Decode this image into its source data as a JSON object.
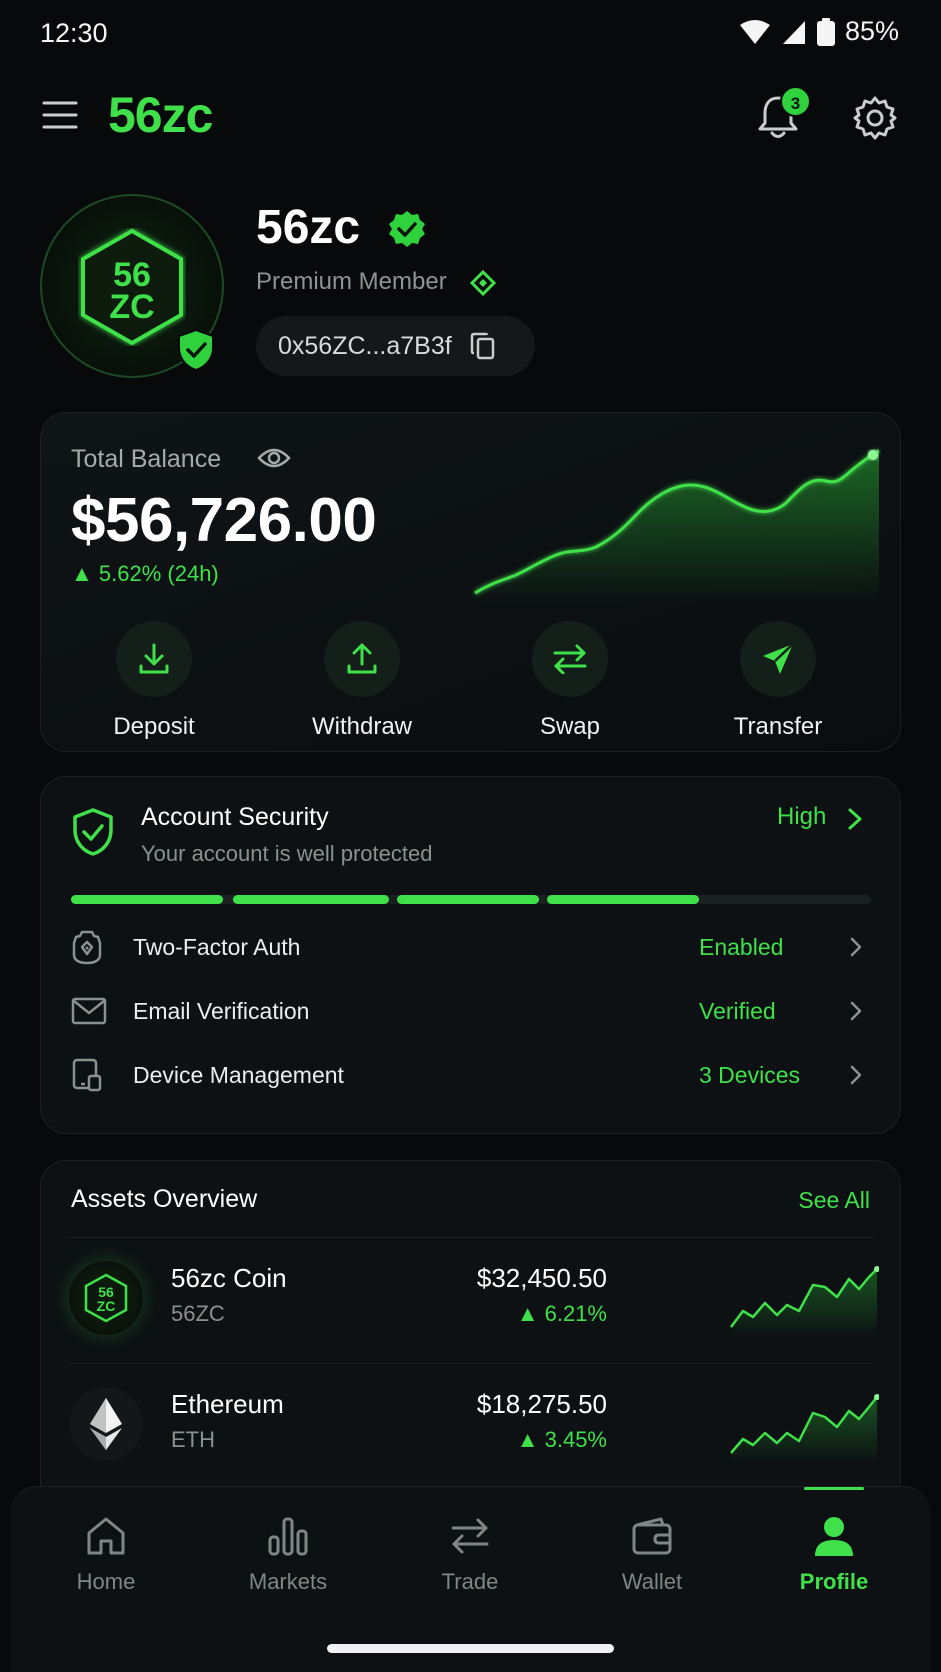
{
  "status_bar": {
    "time": "12:30",
    "battery": "85%"
  },
  "header": {
    "brand": "56zc",
    "notification_count": "3"
  },
  "profile": {
    "avatar_text_top": "56",
    "avatar_text_bottom": "ZC",
    "name": "56zc",
    "membership": "Premium Member",
    "wallet_address": "0x56ZC...a7B3f"
  },
  "balance": {
    "label": "Total Balance",
    "amount": "$56,726.00",
    "change": "5.62% (24h)",
    "actions": [
      {
        "label": "Deposit",
        "icon": "download-icon"
      },
      {
        "label": "Withdraw",
        "icon": "upload-icon"
      },
      {
        "label": "Swap",
        "icon": "swap-icon"
      },
      {
        "label": "Transfer",
        "icon": "send-icon"
      }
    ]
  },
  "security": {
    "title": "Account Security",
    "subtitle": "Your account is well protected",
    "level": "High",
    "level_segments_filled": 4,
    "level_segments_total": 5,
    "items": [
      {
        "label": "Two-Factor Auth",
        "value": "Enabled",
        "icon": "authenticator-icon"
      },
      {
        "label": "Email Verification",
        "value": "Verified",
        "icon": "mail-icon"
      },
      {
        "label": "Device Management",
        "value": "3 Devices",
        "icon": "devices-icon"
      }
    ]
  },
  "assets": {
    "title": "Assets Overview",
    "see_all": "See All",
    "items": [
      {
        "name": "56zc Coin",
        "ticker": "56ZC",
        "price": "$32,450.50",
        "change": "6.21%"
      },
      {
        "name": "Ethereum",
        "ticker": "ETH",
        "price": "$18,275.50",
        "change": "3.45%"
      }
    ]
  },
  "nav": {
    "items": [
      {
        "label": "Home",
        "icon": "home-icon"
      },
      {
        "label": "Markets",
        "icon": "bar-chart-icon"
      },
      {
        "label": "Trade",
        "icon": "swap-icon"
      },
      {
        "label": "Wallet",
        "icon": "wallet-icon"
      },
      {
        "label": "Profile",
        "icon": "user-icon"
      }
    ],
    "active": "Profile"
  },
  "colors": {
    "accent": "#3fe04a",
    "background": "#07090b",
    "card": "#0d1113"
  }
}
